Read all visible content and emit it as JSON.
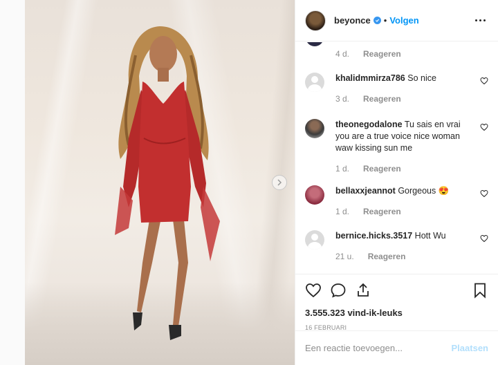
{
  "post": {
    "username": "beyonce",
    "separator": "•",
    "follow_label": "Volgen",
    "likes": "3.555.323 vind-ik-leuks",
    "date": "16 februari"
  },
  "comments": [
    {
      "time": "4 d.",
      "reply": "Reageren"
    },
    {
      "user": "khalidmmirza786",
      "text": "So nice",
      "time": "3 d.",
      "reply": "Reageren"
    },
    {
      "user": "theonegodalone",
      "text": "Tu sais en vrai you are a true voice nice woman waw kissing sun me",
      "time": "1 d.",
      "reply": "Reageren"
    },
    {
      "user": "bellaxxjeannot",
      "text": "Gorgeous 😍",
      "time": "1 d.",
      "reply": "Reageren"
    },
    {
      "user": "bernice.hicks.3517",
      "text": "Hott Wu",
      "time": "21 u.",
      "reply": "Reageren"
    }
  ],
  "composer": {
    "placeholder": "Een reactie toevoegen...",
    "post_label": "Plaatsen"
  },
  "icons": {
    "like": "heart-icon",
    "comment": "speech-bubble-icon",
    "share": "share-icon",
    "save": "bookmark-icon",
    "more": "more-options-icon",
    "next": "chevron-right-icon",
    "verified": "verified-badge-icon"
  },
  "colors": {
    "accent": "#0095f6",
    "verified": "#3897f0",
    "post_disabled": "#b2dffc"
  }
}
